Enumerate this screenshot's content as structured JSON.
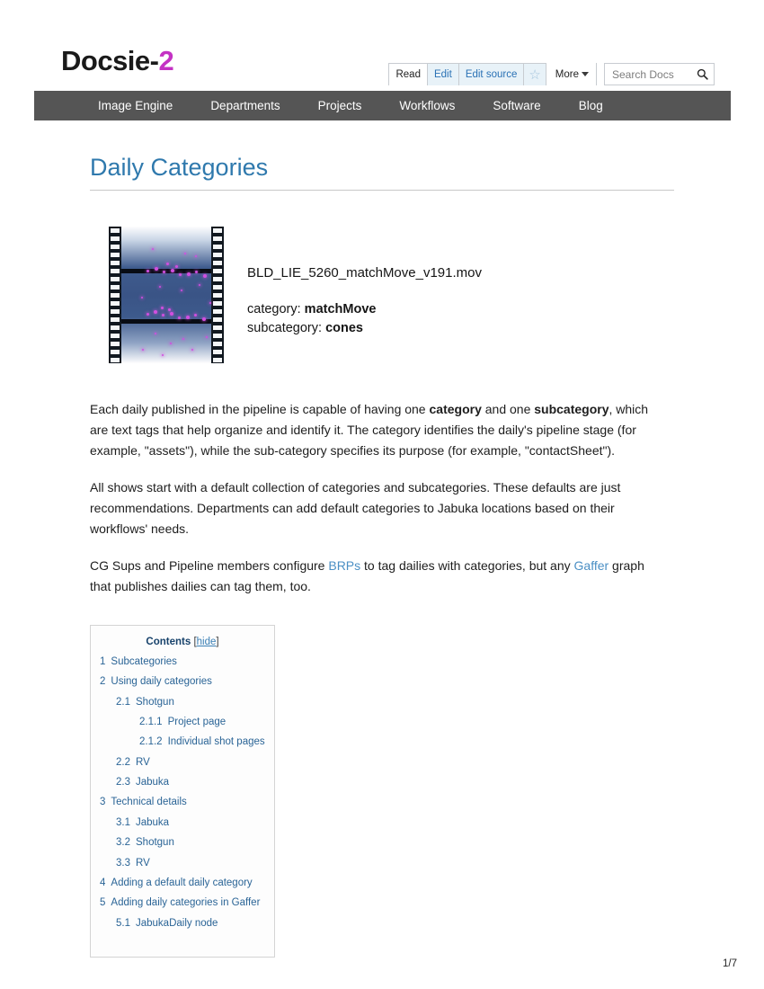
{
  "site": {
    "logo_main": "Docsie-",
    "logo_accent": "2"
  },
  "toolbar": {
    "read_label": "Read",
    "edit_label": "Edit",
    "edit_source_label": "Edit source",
    "watch_icon": "star-outline-icon",
    "more_label": "More",
    "search_placeholder": "Search Docs",
    "search_value": "",
    "search_icon": "magnifier-icon"
  },
  "nav": {
    "items": [
      {
        "label": "Image Engine"
      },
      {
        "label": "Departments"
      },
      {
        "label": "Projects"
      },
      {
        "label": "Workflows"
      },
      {
        "label": "Software"
      },
      {
        "label": "Blog"
      }
    ]
  },
  "page": {
    "title": "Daily Categories",
    "number": "1/7"
  },
  "thumbnail": {
    "icon": "film-strip-icon",
    "filename": "BLD_LIE_5260_matchMove_v191.mov",
    "category_label": "category: ",
    "category_value": "matchMove",
    "subcategory_label": "subcategory: ",
    "subcategory_value": "cones"
  },
  "paragraphs": {
    "p1_a": "Each daily published in the pipeline is capable of having one ",
    "p1_b": "category",
    "p1_c": " and one ",
    "p1_d": "subcategory",
    "p1_e": ", which are text tags that help organize and identify it. The category identifies the daily's pipeline stage (for example, \"assets\"), while the sub-category specifies its purpose (for example, \"contactSheet\").",
    "p2": "All shows start with a default collection of categories and subcategories. These defaults are just recommendations. Departments can add default categories to Jabuka locations based on their workflows' needs.",
    "p3_a": "CG Sups and Pipeline members configure ",
    "p3_link1": "BRPs",
    "p3_b": " to tag dailies with categories, but any ",
    "p3_link2": "Gaffer",
    "p3_c": " graph that publishes dailies can tag them, too."
  },
  "toc": {
    "heading": "Contents",
    "bracket_open": "[",
    "hide_label": "hide",
    "bracket_close": "]",
    "entries": [
      {
        "num": "1",
        "text": "Subcategories",
        "level": 1
      },
      {
        "num": "2",
        "text": "Using daily categories",
        "level": 1
      },
      {
        "num": "2.1",
        "text": "Shotgun",
        "level": 2
      },
      {
        "num": "2.1.1",
        "text": "Project page",
        "level": 3
      },
      {
        "num": "2.1.2",
        "text": "Individual shot pages",
        "level": 3
      },
      {
        "num": "2.2",
        "text": "RV",
        "level": 2
      },
      {
        "num": "2.3",
        "text": "Jabuka",
        "level": 2
      },
      {
        "num": "3",
        "text": "Technical details",
        "level": 1
      },
      {
        "num": "3.1",
        "text": "Jabuka",
        "level": 2
      },
      {
        "num": "3.2",
        "text": "Shotgun",
        "level": 2
      },
      {
        "num": "3.3",
        "text": "RV",
        "level": 2
      },
      {
        "num": "4",
        "text": "Adding a default daily category",
        "level": 1
      },
      {
        "num": "5",
        "text": "Adding daily categories in Gaffer",
        "level": 1
      },
      {
        "num": "5.1",
        "text": "JabukaDaily node",
        "level": 2
      }
    ]
  },
  "colors": {
    "logo_blue": "#2f79ad",
    "logo_magenta": "#c432c4",
    "navbar": "#555555",
    "title_blue": "#2f79ad",
    "link_blue": "#4b8fc4",
    "toc_blue": "#2a6496"
  }
}
